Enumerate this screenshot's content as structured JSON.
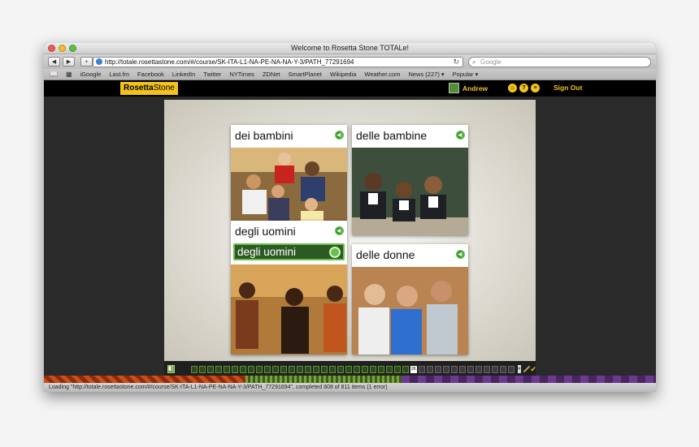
{
  "window": {
    "title": "Welcome to Rosetta Stone TOTALe!"
  },
  "toolbar": {
    "back_icon": "back-arrow-icon",
    "forward_icon": "forward-arrow-icon",
    "add_icon": "plus-icon",
    "url": "http://totale.rosettastone.com/#/course/SK-ITA-L1-NA-PE-NA-NA-Y-3/PATH_77291694",
    "reload_icon": "reload-icon",
    "search_placeholder": "Google"
  },
  "bookmarks": [
    "iGoogle",
    "Last.fm",
    "Facebook",
    "LinkedIn",
    "Twitter",
    "NYTimes",
    "ZDNet",
    "SmartPlanet",
    "Wikipedia",
    "Weather.com",
    "News (227) ▾",
    "Popular ▾"
  ],
  "rosetta": {
    "logo_bold": "Rosetta",
    "logo_light": "Stone",
    "user_name": "Andrew",
    "sign_out": "Sign Out"
  },
  "cards": [
    {
      "label": "dei bambini"
    },
    {
      "label": "delle bambine"
    },
    {
      "label": "degli uomini",
      "answer": "degli uomini"
    },
    {
      "label": "delle donne"
    }
  ],
  "progress": {
    "current": "28",
    "total_cells": 40,
    "completed_cells": 27
  },
  "status": "Loading \"http://totale.rosettastone.com/#/course/SK-ITA-L1-NA-PE-NA-NA-Y-3/PATH_77291694\", completed 808 of 811 items (1 error)",
  "colors": {
    "brand": "#f3c21b",
    "success": "#3a9c29",
    "answer_bg": "#2d5a22"
  }
}
